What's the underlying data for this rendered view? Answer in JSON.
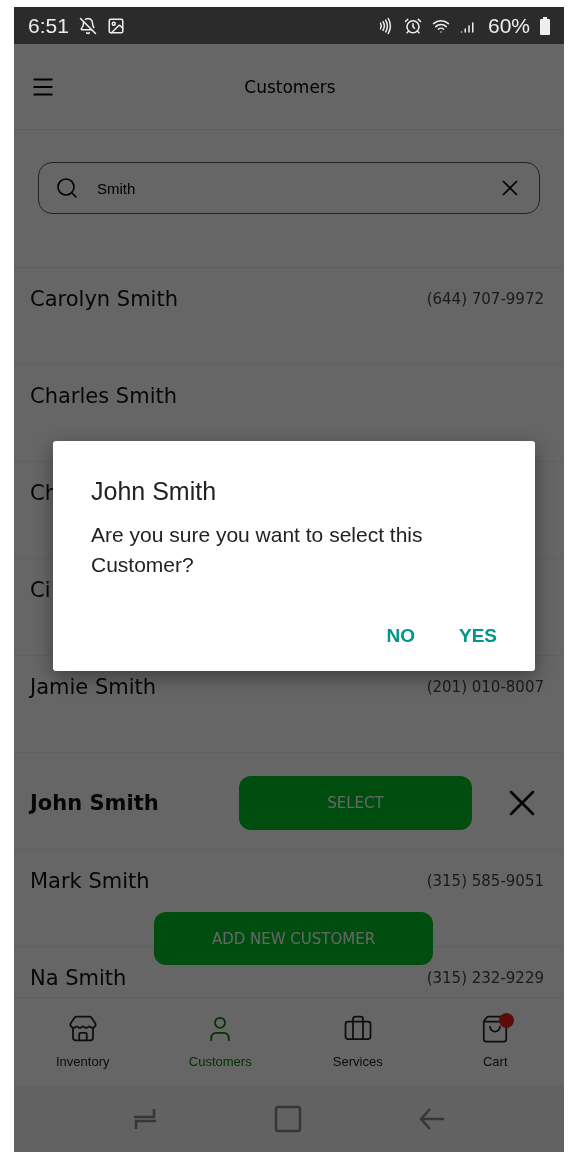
{
  "status_bar": {
    "time": "6:51",
    "battery": "60%"
  },
  "header": {
    "title": "Customers"
  },
  "search": {
    "value": "Smith"
  },
  "customers": [
    {
      "name": "Carolyn Smith",
      "phone": "(644) 707-9972",
      "selected": false
    },
    {
      "name": "Charles Smith",
      "selected": false
    },
    {
      "name": "Ch",
      "selected": false
    },
    {
      "name": "Ci",
      "selected": false
    },
    {
      "name": "Jamie Smith",
      "phone": "(201) 010-8007",
      "selected": false
    },
    {
      "name": "John Smith",
      "selected": true,
      "action": "SELECT"
    },
    {
      "name": "Mark Smith",
      "phone": "(315) 585-9051",
      "selected": false
    },
    {
      "name": "Na Smith",
      "phone": "(315) 232-9229",
      "selected": false
    }
  ],
  "add_button": "ADD NEW CUSTOMER",
  "tabs": [
    {
      "kind": "store",
      "label": "Inventory",
      "selected": false
    },
    {
      "kind": "user",
      "label": "Customers",
      "selected": true
    },
    {
      "kind": "briefcase",
      "label": "Services",
      "selected": false
    },
    {
      "kind": "bag",
      "label": "Cart",
      "selected": false
    }
  ],
  "dialog": {
    "title": "John Smith",
    "message": "Are you sure you want to select this Customer?",
    "buttons": [
      "NO",
      "YES"
    ]
  }
}
